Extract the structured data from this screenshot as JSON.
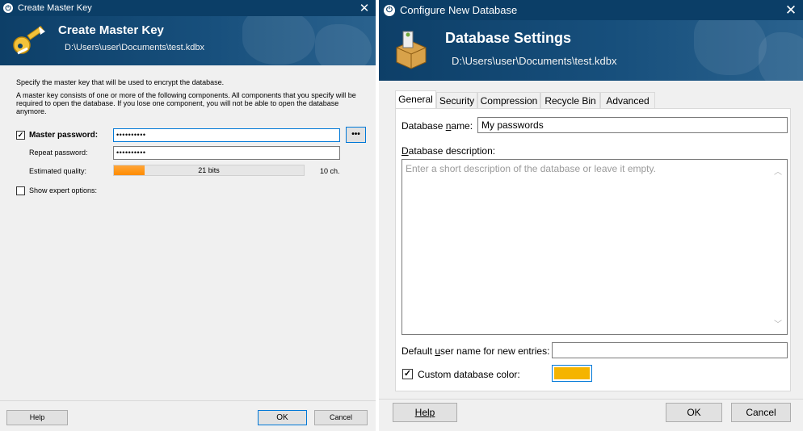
{
  "create_master_key": {
    "title": "Create Master Key",
    "header_title": "Create Master Key",
    "header_path": "D:\\Users\\user\\Documents\\test.kdbx",
    "intro": "Specify the master key that will be used to encrypt the database.",
    "description": "A master key consists of one or more of the following components. All components that you specify will be required to open the database. If you lose one component, you will not be able to open the database anymore.",
    "master_password_label": "Master password:",
    "master_password_value": "••••••••••",
    "repeat_password_label": "Repeat password:",
    "repeat_password_value": "••••••••••",
    "quality_label": "Estimated quality:",
    "quality_bits": "21 bits",
    "quality_chars": "10 ch.",
    "quality_fraction": 0.16,
    "show_expert_label": "Show expert options:",
    "reveal_button": "•••",
    "help": "Help",
    "ok": "OK",
    "cancel": "Cancel"
  },
  "configure_db": {
    "title": "Configure New Database",
    "header_title": "Database Settings",
    "header_path": "D:\\Users\\user\\Documents\\test.kdbx",
    "tabs": [
      "General",
      "Security",
      "Compression",
      "Recycle Bin",
      "Advanced"
    ],
    "db_name_label": "Database name:",
    "db_name_value": "My passwords",
    "db_desc_label": "Database description:",
    "db_desc_placeholder": "Enter a short description of the database or leave it empty.",
    "default_user_label": "Default user name for new entries:",
    "default_user_value": "",
    "custom_color_label": "Custom database color:",
    "custom_color": "#f5b400",
    "help": "Help",
    "ok": "OK",
    "cancel": "Cancel"
  },
  "colors": {
    "titlebar": "#0b3e67",
    "accent_focus": "#0078d7",
    "quality_bar": "#ff8c00"
  }
}
